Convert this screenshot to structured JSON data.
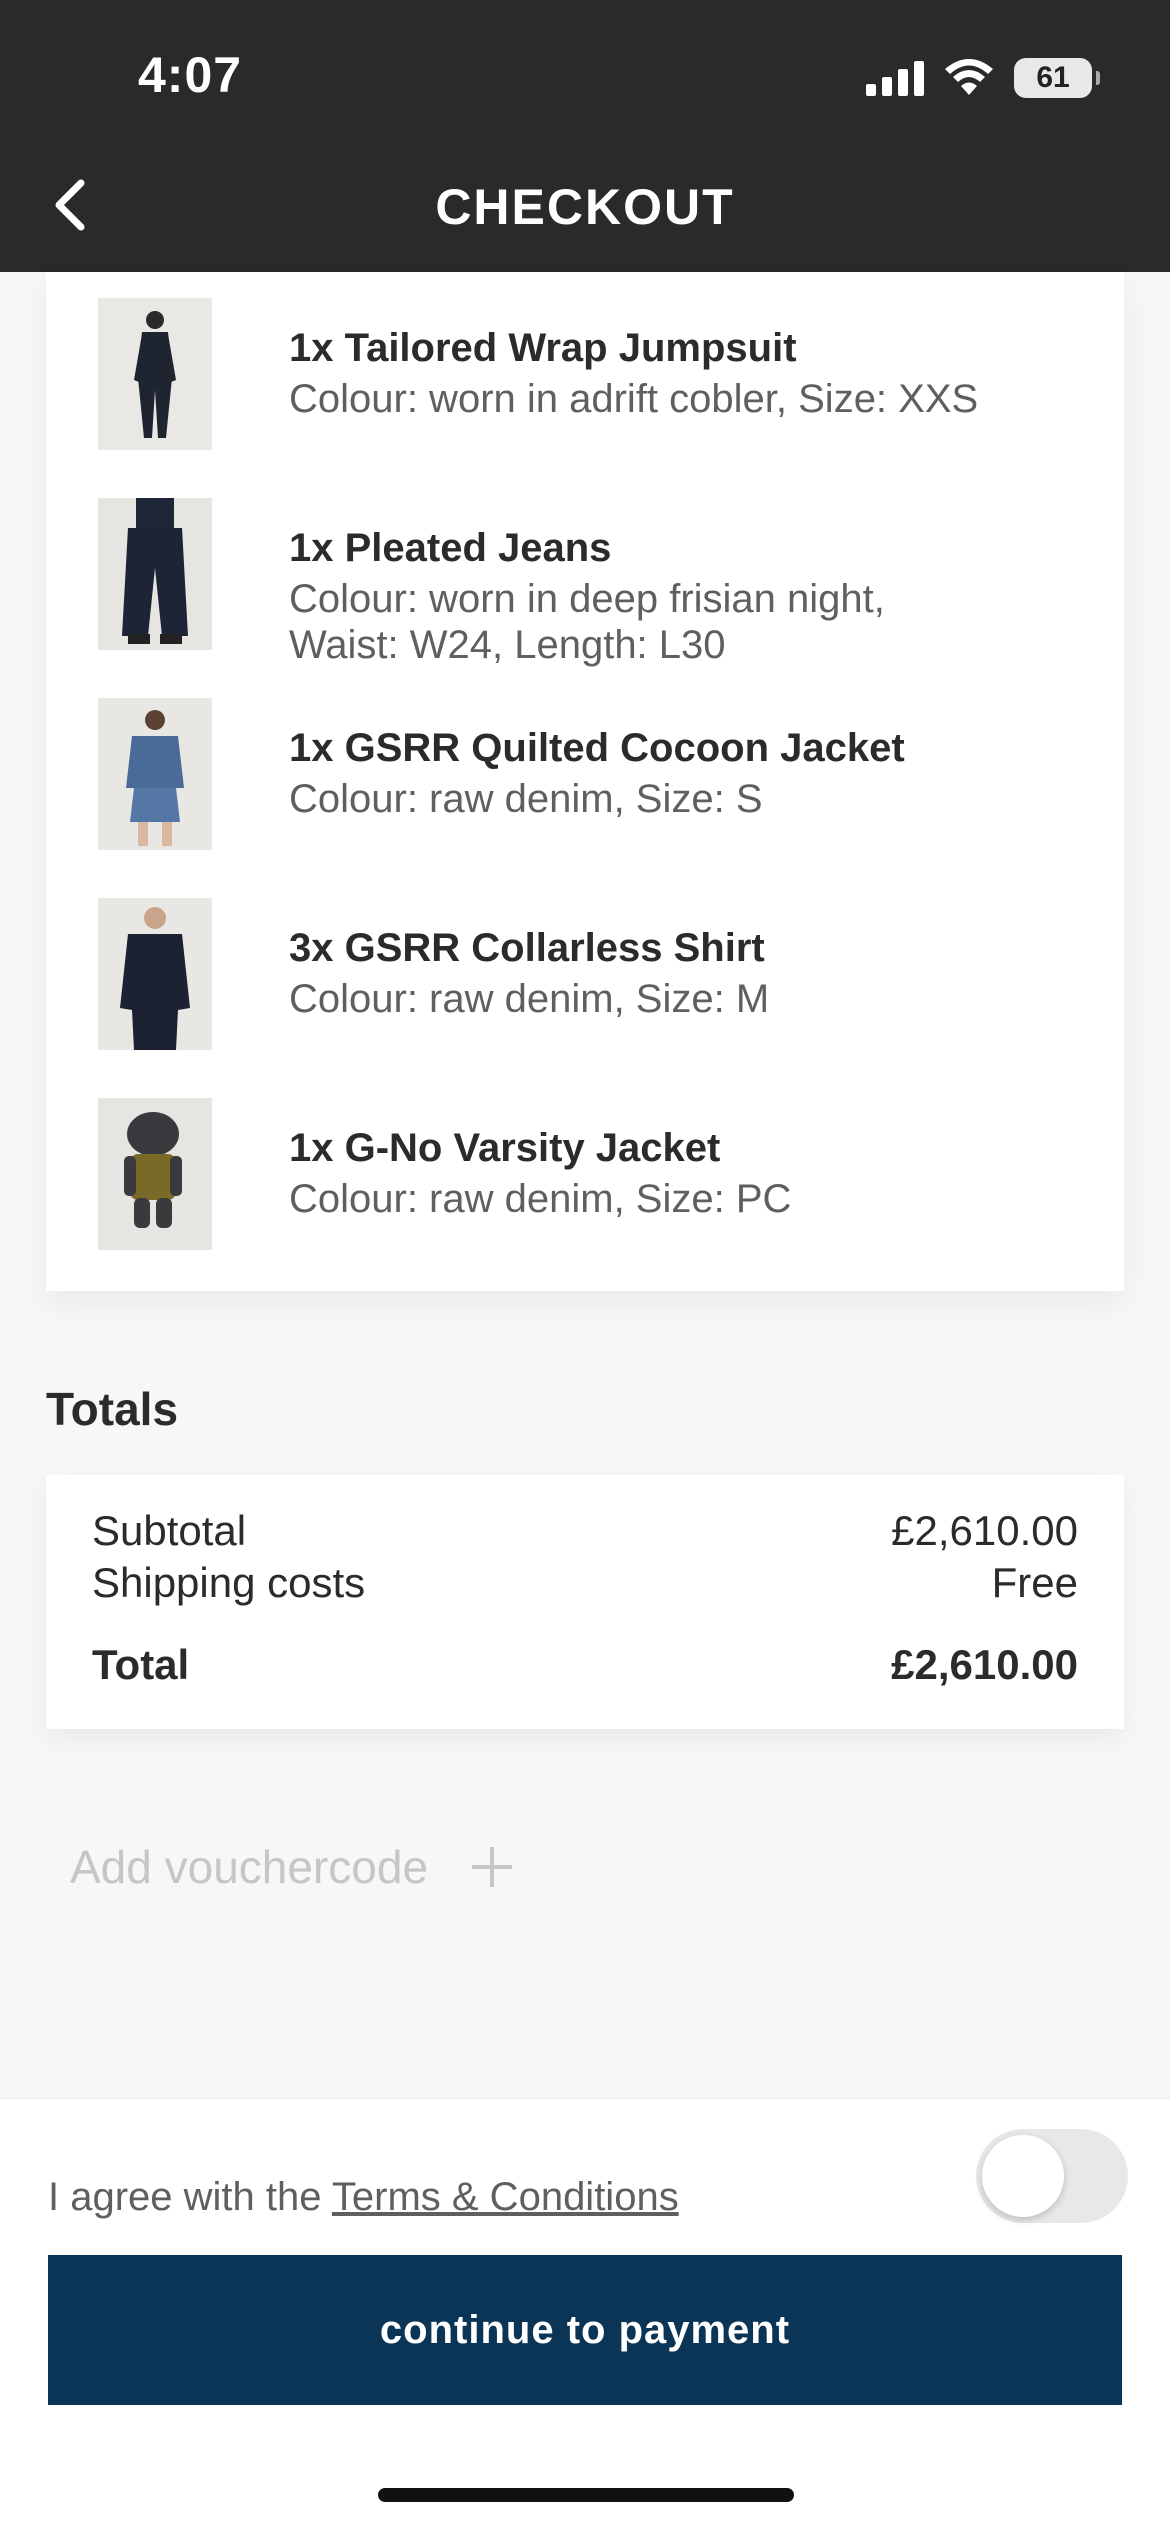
{
  "status_bar": {
    "time": "4:07",
    "battery": "61"
  },
  "header": {
    "title": "CHECKOUT",
    "back_icon": "chevron-left-icon"
  },
  "items": [
    {
      "name": "1x Tailored Wrap Jumpsuit",
      "details": [
        "Colour: worn in adrift cobler, Size: XXS"
      ]
    },
    {
      "name": "1x Pleated Jeans",
      "details": [
        "Colour: worn in deep frisian night,",
        "Waist: W24, Length: L30"
      ]
    },
    {
      "name": "1x GSRR Quilted Cocoon Jacket",
      "details": [
        "Colour: raw denim, Size: S"
      ]
    },
    {
      "name": "3x GSRR Collarless Shirt",
      "details": [
        "Colour: raw denim, Size: M"
      ]
    },
    {
      "name": "1x G-No Varsity Jacket",
      "details": [
        "Colour: raw denim, Size: PC"
      ]
    }
  ],
  "totals": {
    "heading": "Totals",
    "subtotal_label": "Subtotal",
    "subtotal_value": "£2,610.00",
    "shipping_label": "Shipping costs",
    "shipping_value": "Free",
    "total_label": "Total",
    "total_value": "£2,610.00"
  },
  "voucher": {
    "label": "Add vouchercode"
  },
  "terms": {
    "prefix": "I agree with the ",
    "link": "Terms & Conditions",
    "toggle_on": false
  },
  "cta": {
    "label": "continue to payment"
  },
  "colors": {
    "header_bg": "#2a2a2a",
    "cta_bg": "#0b3557"
  }
}
